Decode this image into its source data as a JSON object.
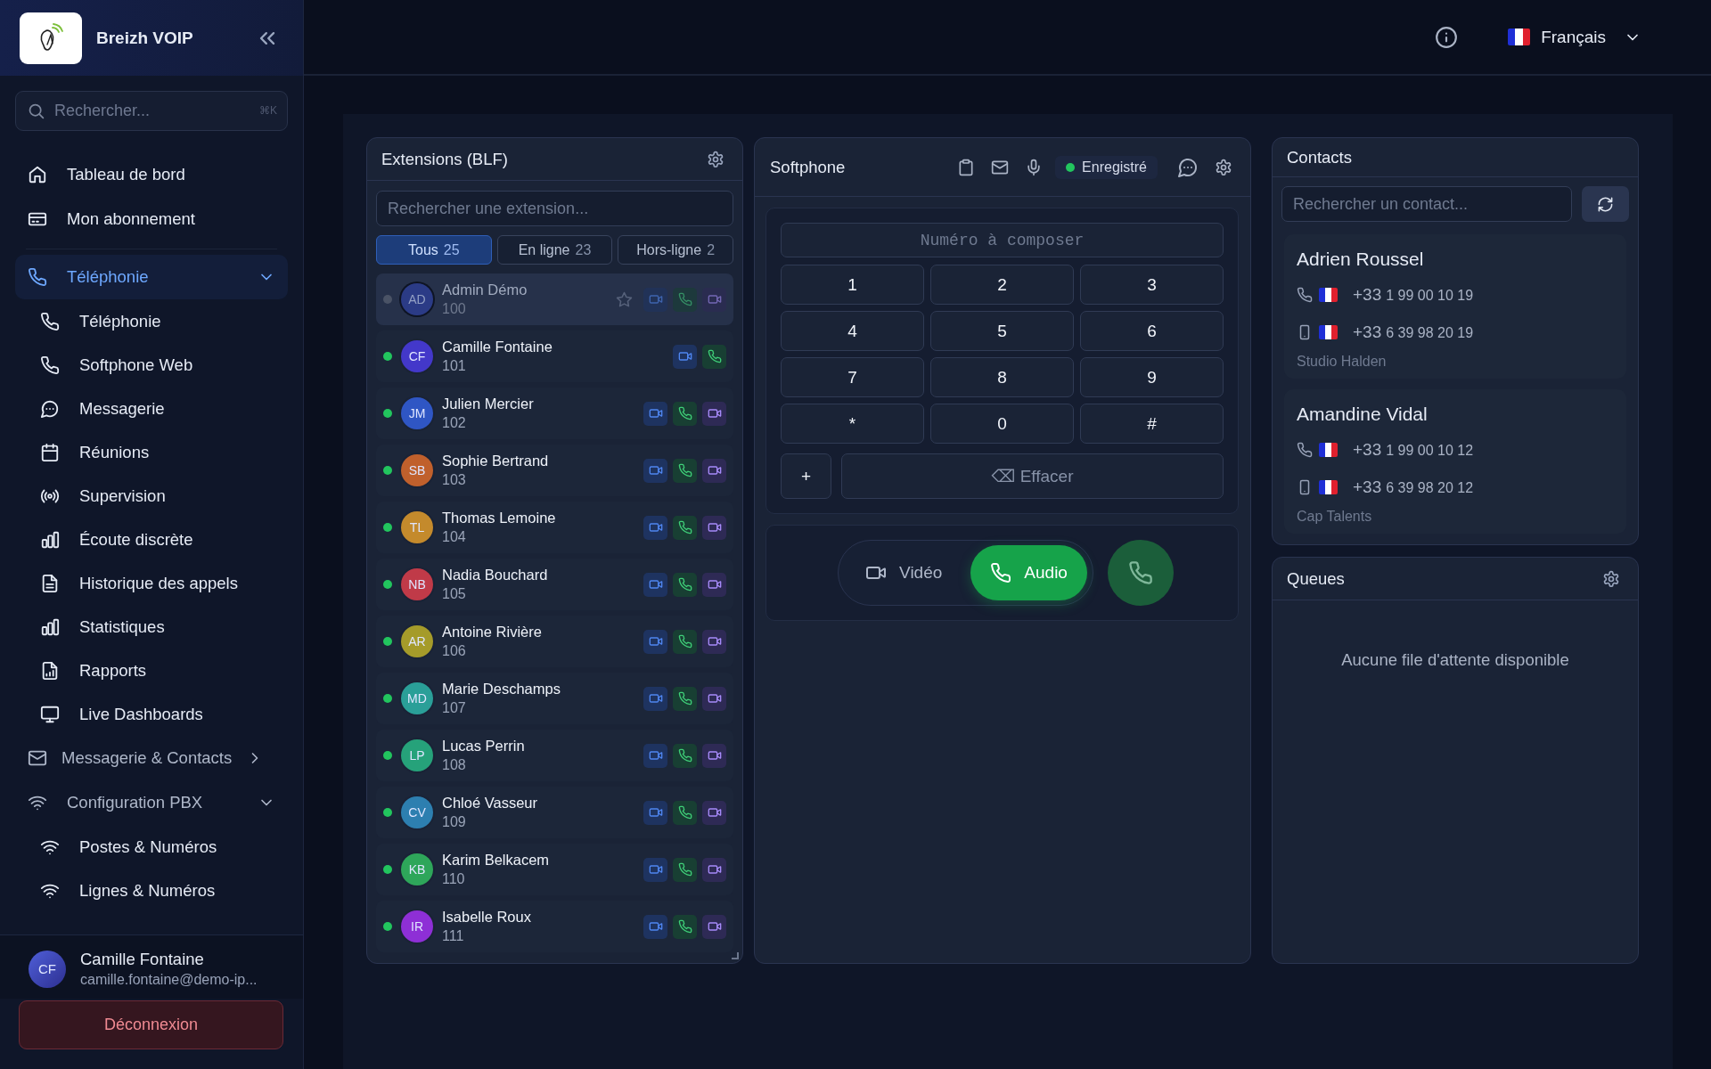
{
  "sidebar": {
    "brand": "Breizh VOIP",
    "search": {
      "placeholder": "Rechercher...",
      "shortcut": "⌘K"
    },
    "nav": [
      {
        "label": "Tableau de bord",
        "selected": false
      },
      {
        "label": "Mon abonnement",
        "selected": false
      },
      {
        "label": "Téléphonie",
        "selected": true,
        "expanded": true,
        "children": [
          {
            "label": "Téléphonie",
            "selected": false
          },
          {
            "label": "Softphone Web",
            "selected": false
          },
          {
            "label": "Messagerie",
            "selected": false
          },
          {
            "label": "Réunions",
            "selected": false
          },
          {
            "label": "Supervision",
            "selected": false
          },
          {
            "label": "Écoute discrète",
            "selected": false
          },
          {
            "label": "Historique des appels",
            "selected": false
          },
          {
            "label": "Statistiques",
            "selected": false
          },
          {
            "label": "Rapports",
            "selected": false
          },
          {
            "label": "Live Dashboards",
            "selected": false
          }
        ]
      },
      {
        "label": "Messagerie & Contacts",
        "selected": false,
        "expanded": false
      },
      {
        "label": "Configuration PBX",
        "selected": false,
        "expanded": true,
        "children": [
          {
            "label": "Postes & Numéros",
            "selected": false
          },
          {
            "label": "Lignes & Numéros",
            "selected": false
          }
        ]
      }
    ],
    "user": {
      "initials": "CF",
      "name": "Camille Fontaine",
      "email": "camille.fontaine@demo-ip..."
    },
    "logout": "Déconnexion"
  },
  "topbar": {
    "language": "Français"
  },
  "extensions": {
    "title": "Extensions (BLF)",
    "search_placeholder": "Rechercher une extension...",
    "filters": [
      {
        "label": "Tous",
        "count": "25",
        "selected": true
      },
      {
        "label": "En ligne",
        "count": "23",
        "selected": false
      },
      {
        "label": "Hors-ligne",
        "count": "2",
        "selected": false
      }
    ],
    "rows": [
      {
        "kind": "peer",
        "initials": "AD",
        "name": "Admin Démo",
        "number": "100",
        "online": false,
        "selected": true,
        "color": "#2b3b86"
      },
      {
        "kind": "self",
        "initials": "CF",
        "name": "Camille Fontaine",
        "number": "101",
        "online": true,
        "selected": false,
        "color": "#4338ca"
      },
      {
        "kind": "peer",
        "initials": "JM",
        "name": "Julien Mercier",
        "number": "102",
        "online": true,
        "selected": false,
        "color": "#2f56c4"
      },
      {
        "kind": "peer",
        "initials": "SB",
        "name": "Sophie Bertrand",
        "number": "103",
        "online": true,
        "selected": false,
        "color": "#c0602c"
      },
      {
        "kind": "peer",
        "initials": "TL",
        "name": "Thomas Lemoine",
        "number": "104",
        "online": true,
        "selected": false,
        "color": "#c48a2c"
      },
      {
        "kind": "peer",
        "initials": "NB",
        "name": "Nadia Bouchard",
        "number": "105",
        "online": true,
        "selected": false,
        "color": "#c03a48"
      },
      {
        "kind": "peer",
        "initials": "AR",
        "name": "Antoine Rivière",
        "number": "106",
        "online": true,
        "selected": false,
        "color": "#a59b2a"
      },
      {
        "kind": "peer",
        "initials": "MD",
        "name": "Marie Deschamps",
        "number": "107",
        "online": true,
        "selected": false,
        "color": "#2a9f98"
      },
      {
        "kind": "peer",
        "initials": "LP",
        "name": "Lucas Perrin",
        "number": "108",
        "online": true,
        "selected": false,
        "color": "#26a27a"
      },
      {
        "kind": "peer",
        "initials": "CV",
        "name": "Chloé Vasseur",
        "number": "109",
        "online": true,
        "selected": false,
        "color": "#2d7fb0"
      },
      {
        "kind": "peer",
        "initials": "KB",
        "name": "Karim Belkacem",
        "number": "110",
        "online": true,
        "selected": false,
        "color": "#2ea65a"
      },
      {
        "kind": "peer",
        "initials": "IR",
        "name": "Isabelle Roux",
        "number": "111",
        "online": true,
        "selected": false,
        "color": "#8e2fd6"
      }
    ]
  },
  "softphone": {
    "title": "Softphone",
    "status": {
      "label": "Enregistré",
      "registered": true
    },
    "dial_placeholder": "Numéro à composer",
    "keys": [
      "1",
      "2",
      "3",
      "4",
      "5",
      "6",
      "7",
      "8",
      "9",
      "*",
      "0",
      "#"
    ],
    "plus_key": "+",
    "clear": "⌫ Effacer",
    "modes": [
      {
        "label": "Vidéo",
        "selected": false
      },
      {
        "label": "Audio",
        "selected": true
      }
    ]
  },
  "contacts": {
    "title": "Contacts",
    "search_placeholder": "Rechercher un contact...",
    "cards": [
      {
        "name": "Adrien Roussel",
        "phones": [
          {
            "kind": "landline",
            "country_code": "+33",
            "number": "1 99 00 10 19"
          },
          {
            "kind": "mobile",
            "country_code": "+33",
            "number": "6 39 98 20 19"
          }
        ],
        "company": "Studio Halden"
      },
      {
        "name": "Amandine Vidal",
        "phones": [
          {
            "kind": "landline",
            "country_code": "+33",
            "number": "1 99 00 10 12"
          },
          {
            "kind": "mobile",
            "country_code": "+33",
            "number": "6 39 98 20 12"
          }
        ],
        "company": "Cap Talents"
      }
    ]
  },
  "queues": {
    "title": "Queues",
    "empty": "Aucune file d'attente disponible"
  }
}
